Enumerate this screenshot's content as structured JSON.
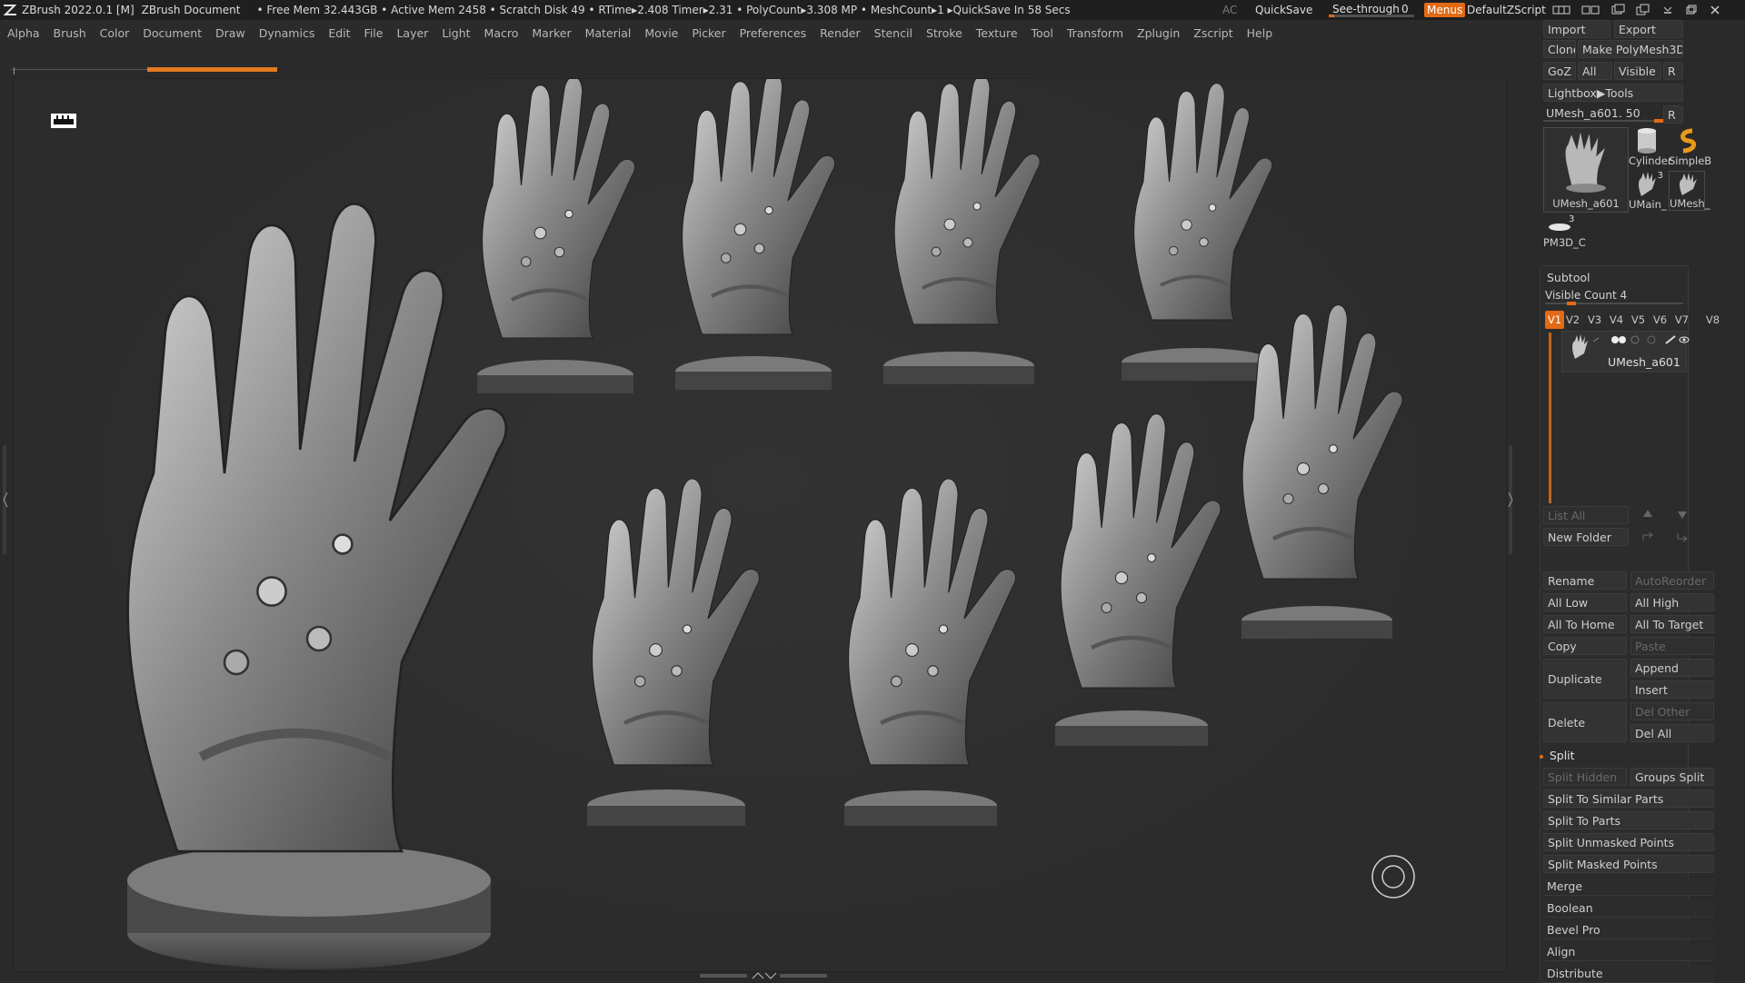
{
  "titlebar": {
    "app": "ZBrush 2022.0.1 [M]",
    "document": "ZBrush Document",
    "stats": "• Free Mem 32.443GB • Active Mem 2458 • Scratch Disk 49 • RTime▸2.408 Timer▸2.31 • PolyCount▸3.308 MP • MeshCount▸1 ▸QuickSave In 58 Secs",
    "ac": "AC",
    "quicksave": "QuickSave",
    "seethrough_label": "See-through",
    "seethrough_value": "0",
    "seethrough_level": 0.0,
    "menus": "Menus",
    "zscript": "DefaultZScript",
    "accent": "#e36a15"
  },
  "menubar": [
    "Alpha",
    "Brush",
    "Color",
    "Document",
    "Draw",
    "Dynamics",
    "Edit",
    "File",
    "Layer",
    "Light",
    "Macro",
    "Marker",
    "Material",
    "Movie",
    "Picker",
    "Preferences",
    "Render",
    "Stencil",
    "Stroke",
    "Texture",
    "Tool",
    "Transform",
    "Zplugin",
    "Zscript",
    "Help"
  ],
  "palette": {
    "import": "Import",
    "export": "Export",
    "clone": "Clone",
    "make_polymesh": "Make PolyMesh3D",
    "goz": "GoZ",
    "all": "All",
    "visible": "Visible",
    "r": "R",
    "lightbox_tools": "Lightbox▶Tools",
    "tool_name": "UMesh_a601. 50",
    "tool_r": "R",
    "thumbs": {
      "main": "UMesh_a601",
      "cylinder": "Cylinder",
      "simpleb": "SimpleB",
      "umain": "UMain_",
      "umesh": "UMesh_",
      "pm3d": "PM3D_C",
      "count_a": "3",
      "count_b": "3"
    },
    "subtool": {
      "title": "Subtool",
      "visible_count": "Visible Count 4",
      "tabs": [
        "V1",
        "V2",
        "V3",
        "V4",
        "V5",
        "V6",
        "V7",
        "V8"
      ],
      "item_name": "UMesh_a601"
    },
    "buttons": {
      "list_all": "List All",
      "new_folder": "New Folder",
      "rename": "Rename",
      "autoreorder": "AutoReorder",
      "all_low": "All Low",
      "all_high": "All High",
      "all_to_home": "All To Home",
      "all_to_target": "All To Target",
      "copy": "Copy",
      "paste": "Paste",
      "duplicate": "Duplicate",
      "append": "Append",
      "insert": "Insert",
      "delete": "Delete",
      "del_other": "Del Other",
      "del_all": "Del All",
      "split": "Split",
      "split_hidden": "Split Hidden",
      "groups_split": "Groups Split",
      "split_similar": "Split To Similar Parts",
      "split_parts": "Split To Parts",
      "split_unmasked": "Split Unmasked Points",
      "split_masked": "Split Masked Points",
      "merge": "Merge",
      "boolean": "Boolean",
      "bevel_pro": "Bevel Pro",
      "align": "Align",
      "distribute": "Distribute"
    }
  }
}
